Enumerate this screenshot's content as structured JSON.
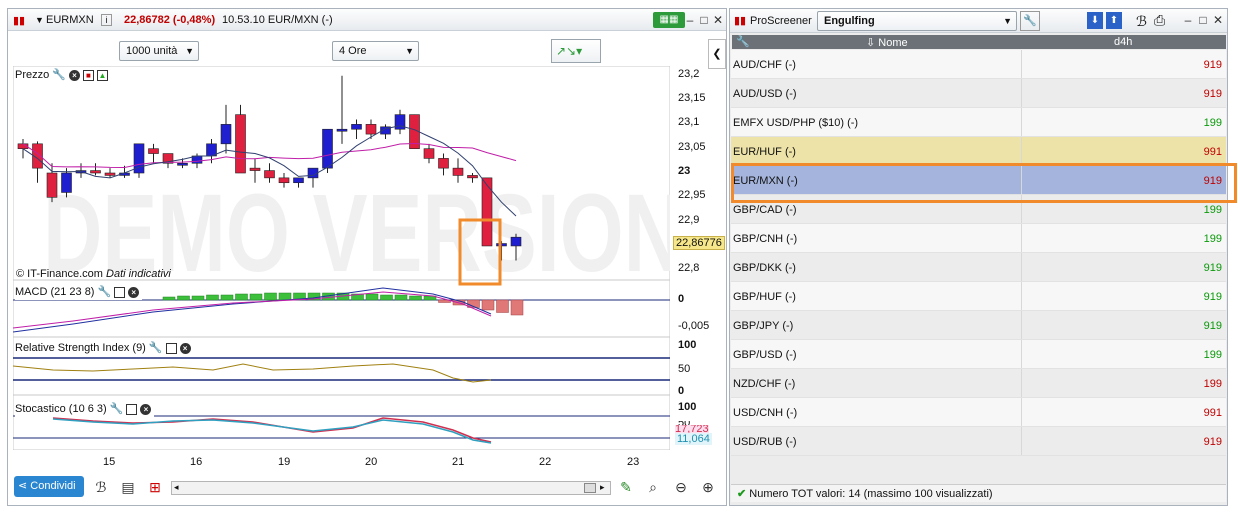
{
  "chart_window": {
    "symbol": "EURMXN",
    "price_info": "22,86782 (-0,48%)",
    "time_info": "10.53.10 EUR/MXN (-)",
    "units_select": "1000 unità",
    "timeframe_select": "4 Ore",
    "price_pane_label": "Prezzo",
    "copyright": "© IT-Finance.com",
    "indicative": "Dati indicativi",
    "watermark": "DEMO VERSION",
    "current_price": "22,86776",
    "macd_label": "MACD (21 23 8)",
    "rsi_label": "Relative Strength Index (9)",
    "stoch_label": "Stocastico (10 6 3)",
    "share_button": "Condividi",
    "price_axis": [
      "23,2",
      "23,15",
      "23,1",
      "23,05",
      "23",
      "22,95",
      "22,9",
      "22,85",
      "22,8"
    ],
    "macd_axis": [
      "0",
      "-0,005"
    ],
    "rsi_axis": [
      "100",
      "50",
      "0"
    ],
    "stoch_axis": [
      "100",
      "50"
    ],
    "stoch_values": [
      "17,723",
      "11,064"
    ],
    "x_axis": [
      "15",
      "16",
      "19",
      "20",
      "21",
      "22",
      "23"
    ],
    "colors": {
      "up": "#1f1fd0",
      "down": "#e0203f",
      "accent": "#f08a2a",
      "highlight_row": "#a4b4dc"
    }
  },
  "chart_data": {
    "type": "candlestick",
    "candles": [
      [
        23.06,
        23.07,
        23.03,
        23.05
      ],
      [
        23.06,
        23.065,
        22.98,
        23.01
      ],
      [
        23.0,
        23.02,
        22.94,
        22.95
      ],
      [
        22.96,
        23.01,
        22.95,
        23.0
      ],
      [
        23.0,
        23.02,
        22.99,
        23.005
      ],
      [
        23.005,
        23.02,
        22.995,
        23.0
      ],
      [
        23.0,
        23.01,
        22.99,
        22.995
      ],
      [
        22.995,
        23.015,
        22.99,
        23.0
      ],
      [
        23.0,
        23.06,
        22.99,
        23.06
      ],
      [
        23.05,
        23.06,
        23.02,
        23.04
      ],
      [
        23.04,
        23.04,
        23.01,
        23.02
      ],
      [
        23.02,
        23.03,
        23.01,
        23.02
      ],
      [
        23.02,
        23.04,
        23.01,
        23.035
      ],
      [
        23.035,
        23.07,
        23.02,
        23.06
      ],
      [
        23.06,
        23.14,
        23.04,
        23.1
      ],
      [
        23.12,
        23.14,
        23.02,
        23.0
      ],
      [
        23.01,
        23.03,
        22.98,
        23.005
      ],
      [
        23.005,
        23.02,
        22.98,
        22.99
      ],
      [
        22.99,
        23.0,
        22.97,
        22.98
      ],
      [
        22.98,
        22.99,
        22.97,
        22.99
      ],
      [
        22.99,
        23.01,
        22.97,
        23.01
      ],
      [
        23.01,
        23.08,
        23.0,
        23.09
      ],
      [
        23.09,
        23.2,
        23.06,
        23.09
      ],
      [
        23.09,
        23.11,
        23.07,
        23.1
      ],
      [
        23.1,
        23.11,
        23.07,
        23.08
      ],
      [
        23.08,
        23.1,
        23.07,
        23.095
      ],
      [
        23.09,
        23.13,
        23.08,
        23.12
      ],
      [
        23.12,
        23.12,
        23.05,
        23.05
      ],
      [
        23.05,
        23.06,
        23.02,
        23.03
      ],
      [
        23.03,
        23.04,
        22.995,
        23.01
      ],
      [
        23.01,
        23.03,
        22.98,
        22.995
      ],
      [
        22.995,
        23.0,
        22.98,
        22.99
      ],
      [
        22.99,
        22.99,
        22.85,
        22.85
      ],
      [
        22.85,
        22.86,
        22.82,
        22.855
      ],
      [
        22.85,
        22.875,
        22.82,
        22.868
      ]
    ],
    "ylim": [
      22.78,
      23.22
    ],
    "x_ticks": [
      "15",
      "16",
      "19",
      "20",
      "21",
      "22",
      "23"
    ]
  },
  "screener": {
    "title": "ProScreener",
    "preset": "Engulfing",
    "col_name": "Nome",
    "col_value": "d4h",
    "rows": [
      {
        "name": "AUD/CHF (-)",
        "value": "919",
        "color": "#c00000"
      },
      {
        "name": "AUD/USD (-)",
        "value": "919",
        "color": "#c00000"
      },
      {
        "name": "EMFX USD/PHP ($10) (-)",
        "value": "199",
        "color": "#0a9a0a"
      },
      {
        "name": "EUR/HUF (-)",
        "value": "991",
        "color": "#c00000"
      },
      {
        "name": "EUR/MXN (-)",
        "value": "919",
        "color": "#c00000"
      },
      {
        "name": "GBP/CAD (-)",
        "value": "199",
        "color": "#0a9a0a"
      },
      {
        "name": "GBP/CNH (-)",
        "value": "199",
        "color": "#0a9a0a"
      },
      {
        "name": "GBP/DKK (-)",
        "value": "919",
        "color": "#0a9a0a"
      },
      {
        "name": "GBP/HUF (-)",
        "value": "919",
        "color": "#0a9a0a"
      },
      {
        "name": "GBP/JPY (-)",
        "value": "919",
        "color": "#0a9a0a"
      },
      {
        "name": "GBP/USD (-)",
        "value": "199",
        "color": "#0a9a0a"
      },
      {
        "name": "NZD/CHF (-)",
        "value": "199",
        "color": "#c00000"
      },
      {
        "name": "USD/CNH (-)",
        "value": "991",
        "color": "#c00000"
      },
      {
        "name": "USD/RUB (-)",
        "value": "919",
        "color": "#c00000"
      }
    ],
    "status": "Numero TOT valori: 14 (massimo 100 visualizzati)"
  }
}
